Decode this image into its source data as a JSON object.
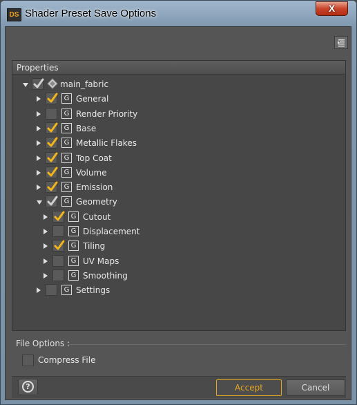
{
  "window": {
    "app_icon_text": "DS",
    "title": "Shader Preset Save Options",
    "close_label": "X"
  },
  "panel": {
    "header": "Properties",
    "tree": [
      {
        "label": "main_fabric",
        "depth": 0,
        "expanded": true,
        "checked": true,
        "partial": true,
        "type": "root"
      },
      {
        "label": "General",
        "depth": 1,
        "expanded": false,
        "checked": true,
        "type": "group"
      },
      {
        "label": "Render Priority",
        "depth": 1,
        "expanded": false,
        "checked": false,
        "type": "group"
      },
      {
        "label": "Base",
        "depth": 1,
        "expanded": false,
        "checked": true,
        "type": "group"
      },
      {
        "label": "Metallic Flakes",
        "depth": 1,
        "expanded": false,
        "checked": true,
        "type": "group"
      },
      {
        "label": "Top Coat",
        "depth": 1,
        "expanded": false,
        "checked": true,
        "type": "group"
      },
      {
        "label": "Volume",
        "depth": 1,
        "expanded": false,
        "checked": true,
        "type": "group"
      },
      {
        "label": "Emission",
        "depth": 1,
        "expanded": false,
        "checked": true,
        "type": "group"
      },
      {
        "label": "Geometry",
        "depth": 1,
        "expanded": true,
        "checked": true,
        "partial": true,
        "type": "group"
      },
      {
        "label": "Cutout",
        "depth": 2,
        "expanded": false,
        "checked": true,
        "type": "group"
      },
      {
        "label": "Displacement",
        "depth": 2,
        "expanded": false,
        "checked": false,
        "type": "group"
      },
      {
        "label": "Tiling",
        "depth": 2,
        "expanded": false,
        "checked": true,
        "type": "group"
      },
      {
        "label": "UV Maps",
        "depth": 2,
        "expanded": false,
        "checked": false,
        "type": "group"
      },
      {
        "label": "Smoothing",
        "depth": 2,
        "expanded": false,
        "checked": false,
        "type": "group"
      },
      {
        "label": "Settings",
        "depth": 1,
        "expanded": false,
        "checked": false,
        "type": "group"
      }
    ],
    "group_icon_letter": "G"
  },
  "file_options": {
    "label": "File Options :",
    "compress_label": "Compress File",
    "compress_checked": false
  },
  "footer": {
    "help_label": "?",
    "accept_label": "Accept",
    "cancel_label": "Cancel"
  },
  "colors": {
    "accent": "#e6a820",
    "check_full": "#f2b61c",
    "check_partial": "#d0d0d0"
  }
}
